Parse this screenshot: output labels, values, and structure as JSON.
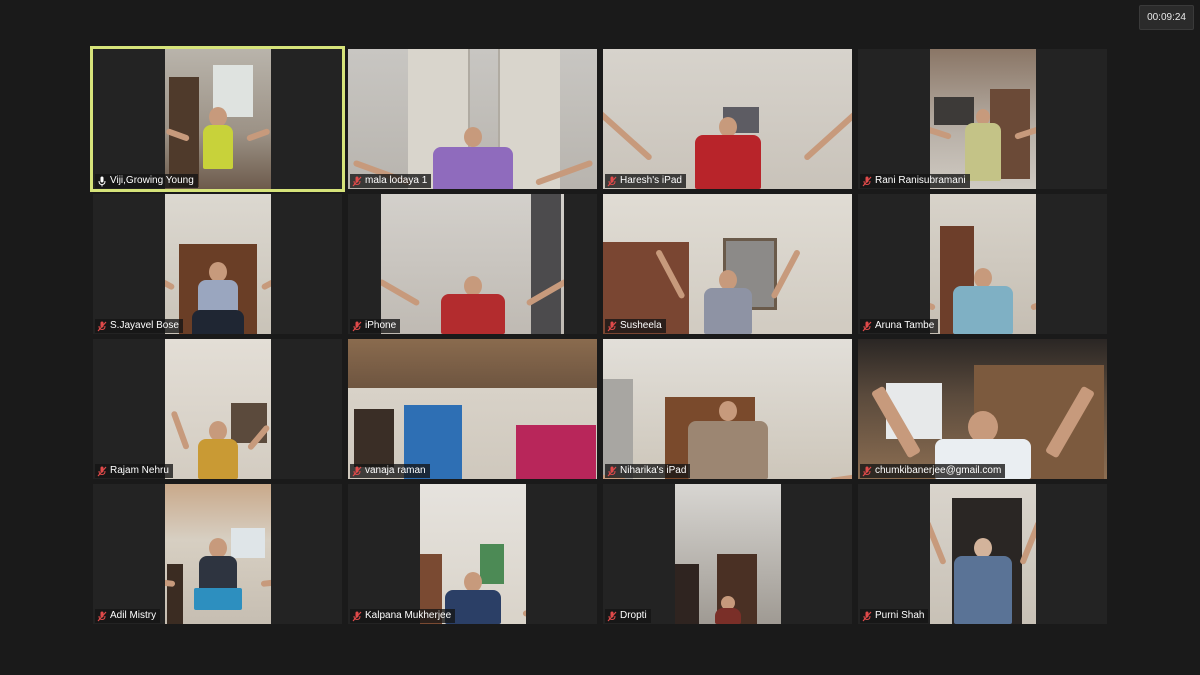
{
  "meeting": {
    "timer": "00:09:24"
  },
  "colors": {
    "active_border": "#d6e37a",
    "muted_mic": "#e04a4a",
    "unmuted_mic": "#ffffff",
    "background": "#1a1a1a"
  },
  "participants": [
    {
      "name": "Viji,Growing Young",
      "muted": false,
      "active": true,
      "icon": "microphone-icon"
    },
    {
      "name": "mala lodaya 1",
      "muted": true,
      "active": false,
      "icon": "muted-microphone-icon"
    },
    {
      "name": "Haresh's iPad",
      "muted": true,
      "active": false,
      "icon": "muted-microphone-icon"
    },
    {
      "name": "Rani Ranisubramani",
      "muted": true,
      "active": false,
      "icon": "muted-microphone-icon"
    },
    {
      "name": "S.Jayavel Bose",
      "muted": true,
      "active": false,
      "icon": "muted-microphone-icon"
    },
    {
      "name": "iPhone",
      "muted": true,
      "active": false,
      "icon": "muted-microphone-icon"
    },
    {
      "name": "Susheela",
      "muted": true,
      "active": false,
      "icon": "muted-microphone-icon"
    },
    {
      "name": "Aruna Tambe",
      "muted": true,
      "active": false,
      "icon": "muted-microphone-icon"
    },
    {
      "name": "Rajam Nehru",
      "muted": true,
      "active": false,
      "icon": "muted-microphone-icon"
    },
    {
      "name": "vanaja raman",
      "muted": true,
      "active": false,
      "icon": "muted-microphone-icon"
    },
    {
      "name": "Niharika's iPad",
      "muted": true,
      "active": false,
      "icon": "muted-microphone-icon"
    },
    {
      "name": "chumkibanerjee@gmail.com",
      "muted": true,
      "active": false,
      "icon": "muted-microphone-icon"
    },
    {
      "name": "Adil Mistry",
      "muted": true,
      "active": false,
      "icon": "muted-microphone-icon"
    },
    {
      "name": "Kalpana Mukherjee",
      "muted": true,
      "active": false,
      "icon": "muted-microphone-icon"
    },
    {
      "name": "Dropti",
      "muted": true,
      "active": false,
      "icon": "muted-microphone-icon"
    },
    {
      "name": "Purni Shah",
      "muted": true,
      "active": false,
      "icon": "muted-microphone-icon"
    }
  ]
}
